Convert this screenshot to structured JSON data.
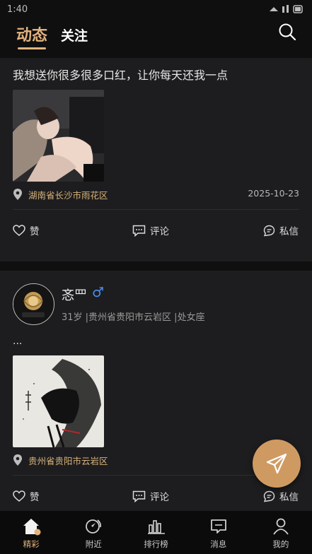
{
  "status_bar": {
    "time": "1:40",
    "icons": "wifi signal battery"
  },
  "header": {
    "tabs": [
      {
        "label": "动态",
        "active": true
      },
      {
        "label": "关注",
        "active": false
      }
    ],
    "search_icon": "search-icon"
  },
  "posts": [
    {
      "text": "我想送你很多很多口红，让你每天还我一点",
      "location": "湖南省长沙市雨花区",
      "date": "2025-10-23",
      "actions": {
        "like": "赞",
        "comment": "评论",
        "message": "私信"
      }
    },
    {
      "username": "忞罒",
      "gender_symbol": "♂",
      "meta": "31岁 |贵州省贵阳市云岩区 |处女座",
      "text": "...",
      "location": "贵州省贵阳市云岩区",
      "actions": {
        "like": "赞",
        "comment": "评论",
        "message": "私信"
      }
    }
  ],
  "fab": {
    "icon": "send-icon"
  },
  "bottom_nav": [
    {
      "label": "精彩",
      "icon": "home-icon",
      "active": true
    },
    {
      "label": "附近",
      "icon": "nearby-icon",
      "active": false
    },
    {
      "label": "排行榜",
      "icon": "ranking-icon",
      "active": false
    },
    {
      "label": "消息",
      "icon": "message-icon",
      "active": false
    },
    {
      "label": "我的",
      "icon": "profile-icon",
      "active": false
    }
  ],
  "colors": {
    "accent": "#e3b27d",
    "location": "#d8b37a",
    "gender": "#4a8ef0",
    "card": "#1d1d1f",
    "fab": "#cf9a62"
  }
}
